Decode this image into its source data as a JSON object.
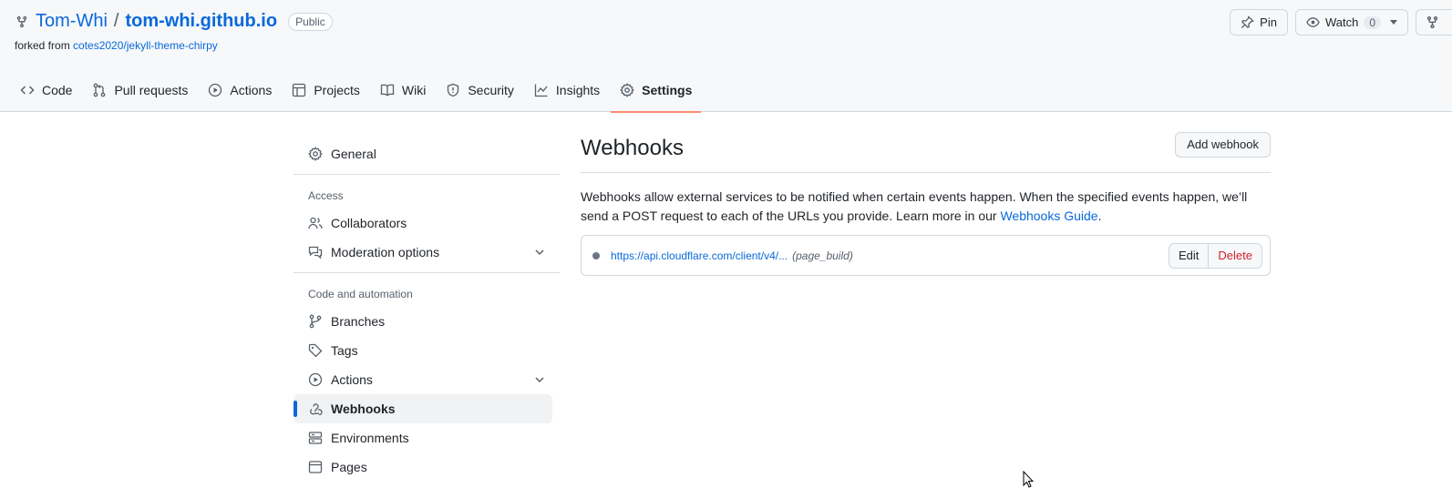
{
  "repo": {
    "owner": "Tom-Whi",
    "separator": "/",
    "name": "tom-whi.github.io",
    "visibility": "Public",
    "forked_prefix": "forked from",
    "forked_source": "cotes2020/jekyll-theme-chirpy"
  },
  "header_actions": {
    "pin_label": "Pin",
    "watch_label": "Watch",
    "watch_count": "0"
  },
  "tabs": [
    {
      "label": "Code",
      "icon": "code-icon"
    },
    {
      "label": "Pull requests",
      "icon": "pull-request-icon"
    },
    {
      "label": "Actions",
      "icon": "play-icon"
    },
    {
      "label": "Projects",
      "icon": "table-icon"
    },
    {
      "label": "Wiki",
      "icon": "book-icon"
    },
    {
      "label": "Security",
      "icon": "shield-icon"
    },
    {
      "label": "Insights",
      "icon": "graph-icon"
    },
    {
      "label": "Settings",
      "icon": "gear-icon",
      "active": true
    }
  ],
  "sidebar": {
    "general": "General",
    "access_heading": "Access",
    "collaborators": "Collaborators",
    "moderation": "Moderation options",
    "code_heading": "Code and automation",
    "branches": "Branches",
    "tags": "Tags",
    "actions": "Actions",
    "webhooks": "Webhooks",
    "environments": "Environments",
    "pages": "Pages",
    "active_item": "Webhooks"
  },
  "main": {
    "title": "Webhooks",
    "add_button": "Add webhook",
    "description": "Webhooks allow external services to be notified when certain events happen. When the specified events happen, we’ll send a POST request to each of the URLs you provide. Learn more in our ",
    "guide_link": "Webhooks Guide",
    "description_end": ".",
    "hook": {
      "url": "https://api.cloudflare.com/client/v4/...",
      "events": "(page_build)",
      "edit_label": "Edit",
      "delete_label": "Delete"
    }
  },
  "colors": {
    "link": "#0969da",
    "active_tab_underline": "#fd8c73",
    "active_sidebar_bar": "#0969da",
    "delete": "#cf222e"
  }
}
